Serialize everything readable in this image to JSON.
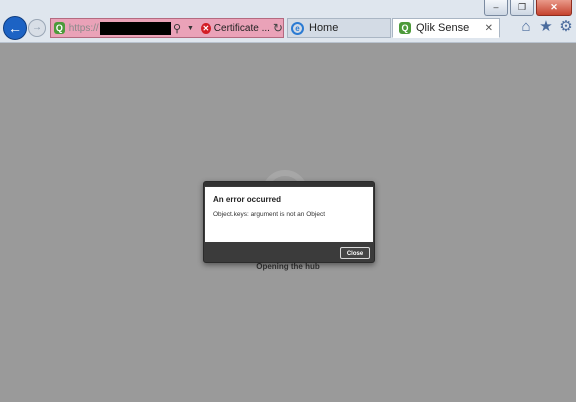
{
  "browser": {
    "address": {
      "url_prefix": "https://",
      "certificate_label": "Certificate ..."
    },
    "tabs": [
      {
        "label": "Home"
      },
      {
        "label": "Qlik Sense"
      }
    ],
    "tab_close_glyph": "✕",
    "window_controls": {
      "minimize": "–",
      "maximize": "❐",
      "close": "✕"
    },
    "tools": {
      "home_icon": "home-icon",
      "favorites_icon": "star-icon",
      "settings_icon": "gear-icon"
    }
  },
  "page": {
    "loading_text": "Opening the hub"
  },
  "dialog": {
    "title": "An error occurred",
    "message": "Object.keys: argument is not an Object",
    "close_label": "Close"
  }
}
